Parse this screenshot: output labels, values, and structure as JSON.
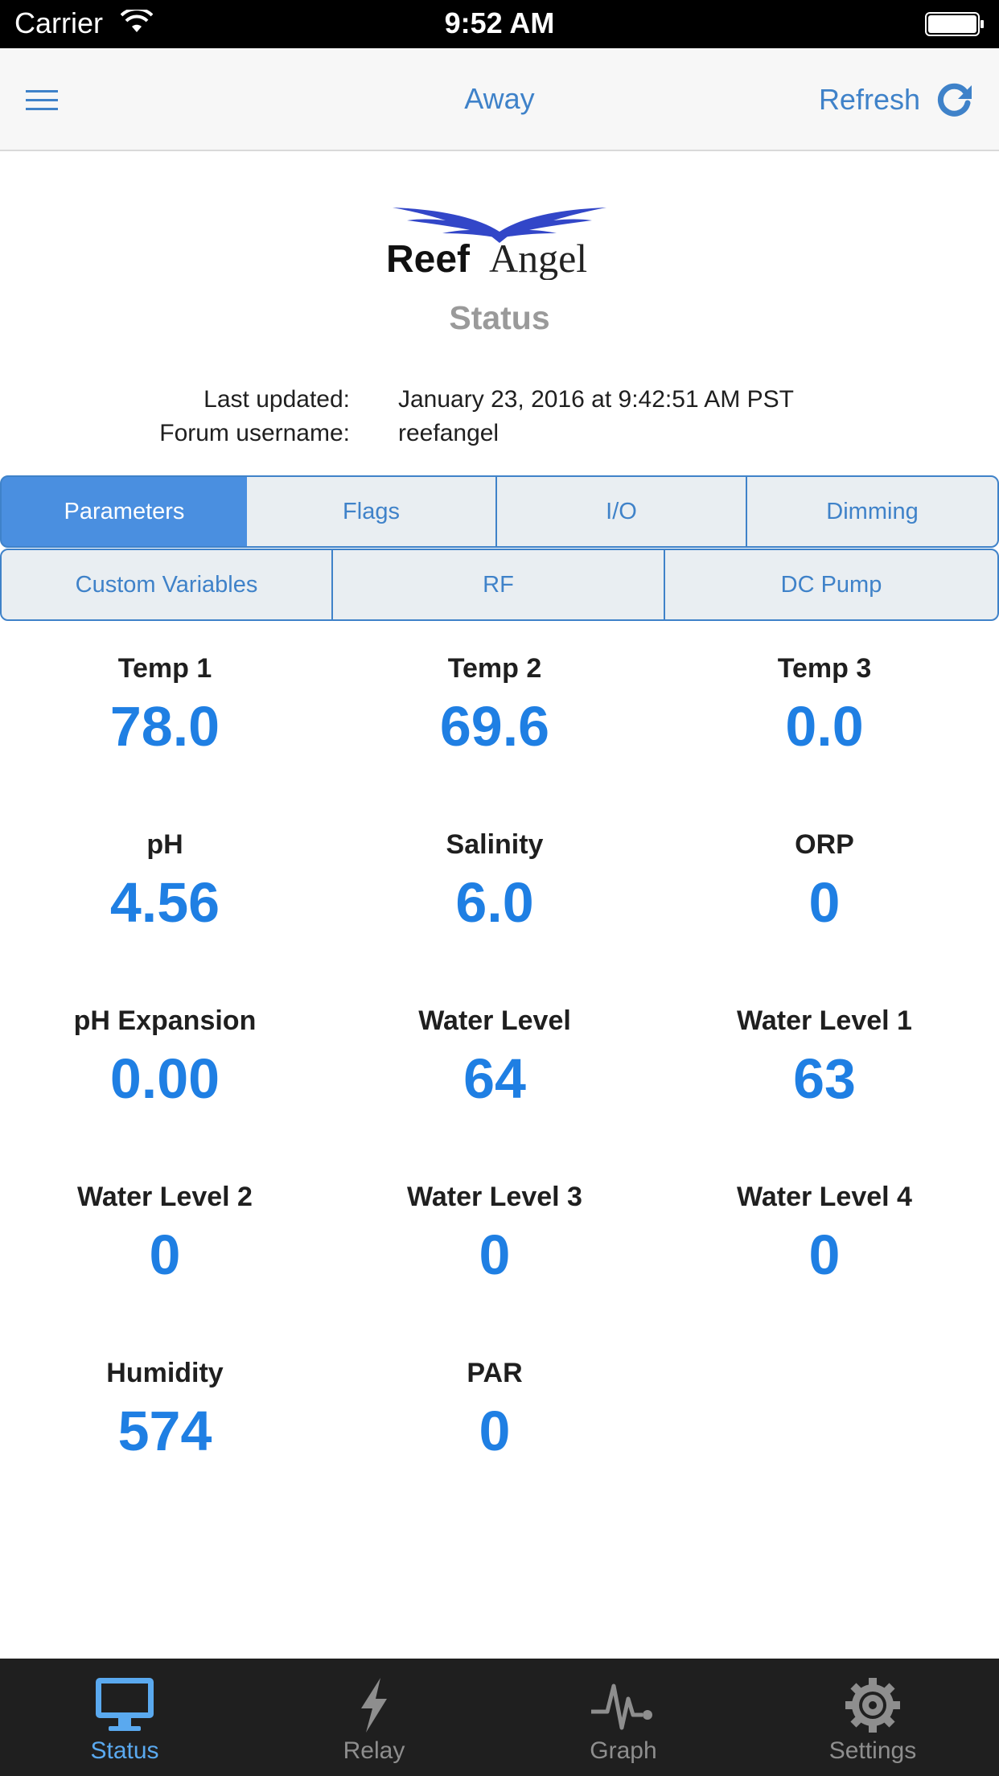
{
  "status_bar": {
    "carrier": "Carrier",
    "time": "9:52 AM"
  },
  "navbar": {
    "title": "Away",
    "refresh_label": "Refresh"
  },
  "logo": {
    "text_bold": "Reef",
    "text_light": "Angel"
  },
  "header": {
    "title": "Status"
  },
  "meta": {
    "last_updated_label": "Last updated:",
    "last_updated_value": "January 23, 2016 at 9:42:51 AM PST",
    "forum_username_label": "Forum username:",
    "forum_username_value": "reefangel"
  },
  "segments_row1": [
    {
      "label": "Parameters",
      "selected": true
    },
    {
      "label": "Flags",
      "selected": false
    },
    {
      "label": "I/O",
      "selected": false
    },
    {
      "label": "Dimming",
      "selected": false
    }
  ],
  "segments_row2": [
    {
      "label": "Custom Variables",
      "selected": false
    },
    {
      "label": "RF",
      "selected": false
    },
    {
      "label": "DC Pump",
      "selected": false
    }
  ],
  "parameters": [
    {
      "label": "Temp 1",
      "value": "78.0"
    },
    {
      "label": "Temp 2",
      "value": "69.6"
    },
    {
      "label": "Temp 3",
      "value": "0.0"
    },
    {
      "label": "pH",
      "value": "4.56"
    },
    {
      "label": "Salinity",
      "value": "6.0"
    },
    {
      "label": "ORP",
      "value": "0"
    },
    {
      "label": "pH Expansion",
      "value": "0.00"
    },
    {
      "label": "Water Level",
      "value": "64"
    },
    {
      "label": "Water Level 1",
      "value": "63"
    },
    {
      "label": "Water Level 2",
      "value": "0"
    },
    {
      "label": "Water Level 3",
      "value": "0"
    },
    {
      "label": "Water Level 4",
      "value": "0"
    },
    {
      "label": "Humidity",
      "value": "574"
    },
    {
      "label": "PAR",
      "value": "0"
    }
  ],
  "tabbar": {
    "items": [
      {
        "label": "Status",
        "icon": "monitor-icon",
        "active": true
      },
      {
        "label": "Relay",
        "icon": "lightning-icon",
        "active": false
      },
      {
        "label": "Graph",
        "icon": "pulse-icon",
        "active": false
      },
      {
        "label": "Settings",
        "icon": "gear-icon",
        "active": false
      }
    ]
  },
  "colors": {
    "accent": "#3f82c9",
    "value_blue": "#1f7fe3",
    "tab_active": "#5aa9ef",
    "tabbar_bg": "#1f1f1f"
  }
}
